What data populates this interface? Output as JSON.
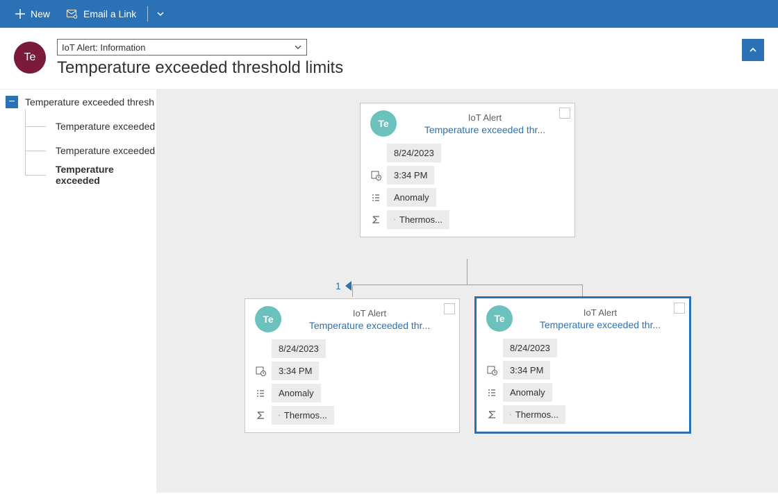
{
  "ribbon": {
    "new_label": "New",
    "email_link_label": "Email a Link"
  },
  "header": {
    "avatar_initials": "Te",
    "form_selector": "IoT Alert: Information",
    "page_title": "Temperature exceeded threshold limits"
  },
  "tree": {
    "root_label": "Temperature exceeded thresh",
    "children": [
      {
        "label": "Temperature exceeded",
        "selected": false
      },
      {
        "label": "Temperature exceeded",
        "selected": false
      },
      {
        "label": "Temperature exceeded",
        "selected": true
      }
    ]
  },
  "canvas": {
    "child_count": "1",
    "cards": {
      "parent": {
        "avatar": "Te",
        "type_label": "IoT Alert",
        "title": "Temperature exceeded thr...",
        "date": "8/24/2023",
        "time": "3:34 PM",
        "status": "Anomaly",
        "device_label": "Thermos..."
      },
      "child_left": {
        "avatar": "Te",
        "type_label": "IoT Alert",
        "title": "Temperature exceeded thr...",
        "date": "8/24/2023",
        "time": "3:34 PM",
        "status": "Anomaly",
        "device_label": "Thermos..."
      },
      "child_right": {
        "avatar": "Te",
        "type_label": "IoT Alert",
        "title": "Temperature exceeded thr...",
        "date": "8/24/2023",
        "time": "3:34 PM",
        "status": "Anomaly",
        "device_label": "Thermos..."
      }
    }
  }
}
